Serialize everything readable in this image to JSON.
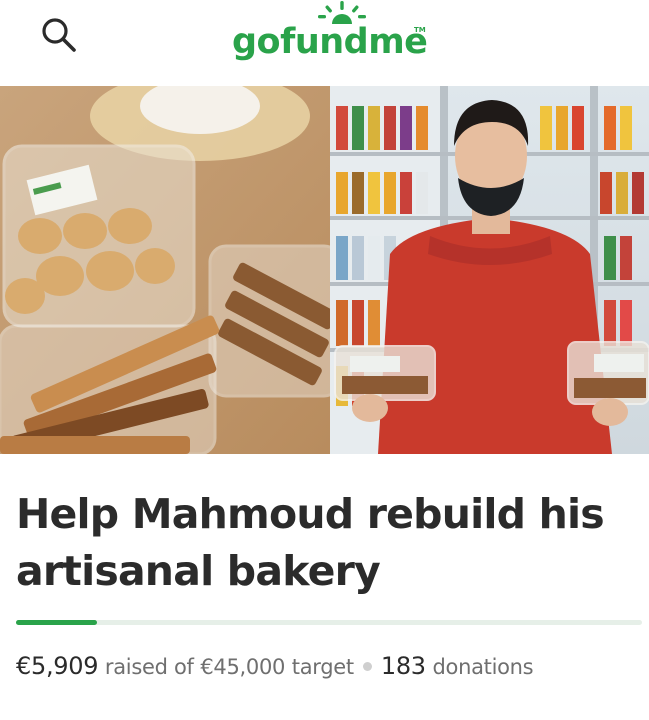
{
  "header": {
    "logo_text": "gofundme",
    "logo_tm": "TM",
    "brand_color": "#2aa34a",
    "search_icon": "search-icon"
  },
  "campaign": {
    "title": "Help Mahmoud rebuild his artisanal bakery",
    "raised": "€5,909",
    "raised_of": "raised of",
    "target": "€45,000",
    "target_label": "target",
    "donations_count": "183",
    "donations_label": "donations",
    "progress_fraction": 0.13
  }
}
